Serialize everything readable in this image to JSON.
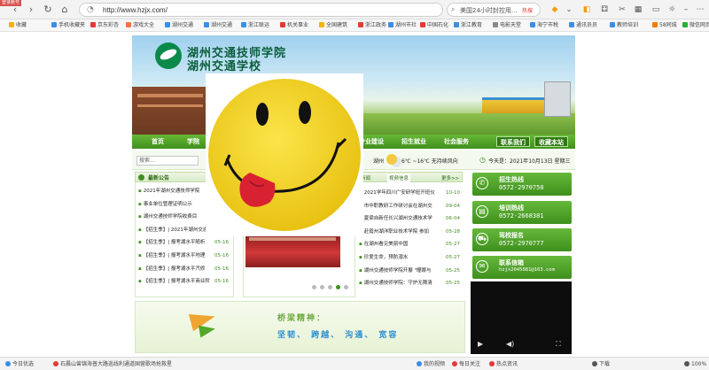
{
  "browser": {
    "login_tag": "登录账号",
    "url": "http://www.hzjx.com/",
    "search_text": "美国24小时封控用...",
    "search_hot": "热搜",
    "nav_icons": [
      "back-icon",
      "forward-icon",
      "reload-icon",
      "home-icon"
    ]
  },
  "bookmarks": [
    {
      "label": "收藏",
      "color": "#f5b400"
    },
    {
      "label": "手机收藏夹",
      "color": "#3a8ee6"
    },
    {
      "label": "京东彩杏",
      "color": "#e53935"
    },
    {
      "label": "游戏大全",
      "color": "#ff7043"
    },
    {
      "label": "湖州交通",
      "color": "#3a8ee6"
    },
    {
      "label": "湖州交通",
      "color": "#3a8ee6"
    },
    {
      "label": "浙江联运",
      "color": "#3a8ee6"
    },
    {
      "label": "机关事业",
      "color": "#e53935"
    },
    {
      "label": "全国建筑",
      "color": "#f5b400"
    },
    {
      "label": "浙江政务",
      "color": "#e53935"
    },
    {
      "label": "湖州市社",
      "color": "#3a8ee6"
    },
    {
      "label": "中国石化",
      "color": "#e53935"
    },
    {
      "label": "浙江教育",
      "color": "#3a8ee6"
    },
    {
      "label": "电影天堂",
      "color": "#888888"
    },
    {
      "label": "海宁市税",
      "color": "#3a8ee6"
    },
    {
      "label": "通讯员员",
      "color": "#3a8ee6"
    },
    {
      "label": "教师培训",
      "color": "#3a8ee6"
    },
    {
      "label": "58同城",
      "color": "#f57c00"
    },
    {
      "label": "微信网页",
      "color": "#2bae3a"
    }
  ],
  "site": {
    "school_name_1": "湖州交通技师学院",
    "school_name_2": "湖州交通学校",
    "nav": [
      {
        "label": "首页"
      },
      {
        "label": "学院"
      },
      {
        "label": "专业建设"
      },
      {
        "label": "招生就业"
      },
      {
        "label": "社会服务"
      }
    ],
    "nav_buttons": [
      {
        "label": "联系我们"
      },
      {
        "label": "收藏本站"
      }
    ],
    "search_placeholder": "搜索...",
    "weather": {
      "city": "湖州",
      "text": "6℃ ~16℃ 无持续风向"
    },
    "date_text": "今天是：2021年10月13日 星期三",
    "notice": {
      "title": "最新公告",
      "items": [
        {
          "text": "2021年湖州交通技师学院",
          "date": ""
        },
        {
          "text": "事业单位管理证明公示",
          "date": ""
        },
        {
          "text": "湖州交通技师学院收费目",
          "date": ""
        },
        {
          "text": "【招生季】| 2021年湖州交通",
          "date": "05-16"
        },
        {
          "text": "【招生季】| 报考湖水平随析",
          "date": "05-16"
        },
        {
          "text": "【招生季】| 报考湖水平地理",
          "date": "05-16"
        },
        {
          "text": "【招生季】| 报考湖水平汽修",
          "date": "05-16"
        },
        {
          "text": "【招生季】| 报考湖水平商业阶",
          "date": "05-16"
        }
      ]
    },
    "center": {
      "dots": 5
    },
    "news": {
      "tabs": [
        "新闻",
        "视频信息"
      ],
      "more": "更多>>",
      "items": [
        {
          "text": "2021学年四川广安研学班开班仪",
          "date": "10-10"
        },
        {
          "text": "市中职教研工作研讨会在湖州交",
          "date": "09-04"
        },
        {
          "text": "夏梁自新任长兴湖州交通技术学",
          "date": "06-04"
        },
        {
          "text": "赴霞州湖洋职业技术学院 参加",
          "date": "05-28"
        },
        {
          "text": "在湖州看见美丽中国",
          "date": "05-27"
        },
        {
          "text": "珍爱生命，预防溺水",
          "date": "05-27"
        },
        {
          "text": "湖州交通技师学院开展 \"瞳眼与",
          "date": "05-25"
        },
        {
          "text": "湖州交通技师学院：守护无障清",
          "date": "05-25"
        }
      ]
    },
    "hotlines": [
      {
        "title": "招生热线",
        "number": "0572-2970750",
        "icon": "phone-icon"
      },
      {
        "title": "培训热线",
        "number": "0572-2668381",
        "icon": "document-icon"
      },
      {
        "title": "驾校报名",
        "number": "0572-2970777",
        "icon": "car-icon"
      },
      {
        "title": "联系信箱",
        "number": "hzjx2045081@163.com",
        "icon": "mail-icon"
      }
    ],
    "slogan": {
      "title": "桥梁精神：",
      "words": "坚韧、 跨越、 沟通、 宽容"
    }
  },
  "status": {
    "left": "今日优选",
    "ticker": "石晨山曾锦海普大路巡线利通道国营歌场抢救星",
    "items": [
      {
        "label": "我的视频",
        "color": "#3a8ee6"
      },
      {
        "label": "每日关注",
        "color": "#e53935"
      },
      {
        "label": "热点资讯",
        "color": "#e53935"
      },
      {
        "label": "下载",
        "color": "#555555"
      },
      {
        "label": "100%",
        "color": "#555555"
      }
    ]
  },
  "colors": {
    "brand_green": "#3f8f1d",
    "smiley_yellow": "#f2d21c"
  }
}
